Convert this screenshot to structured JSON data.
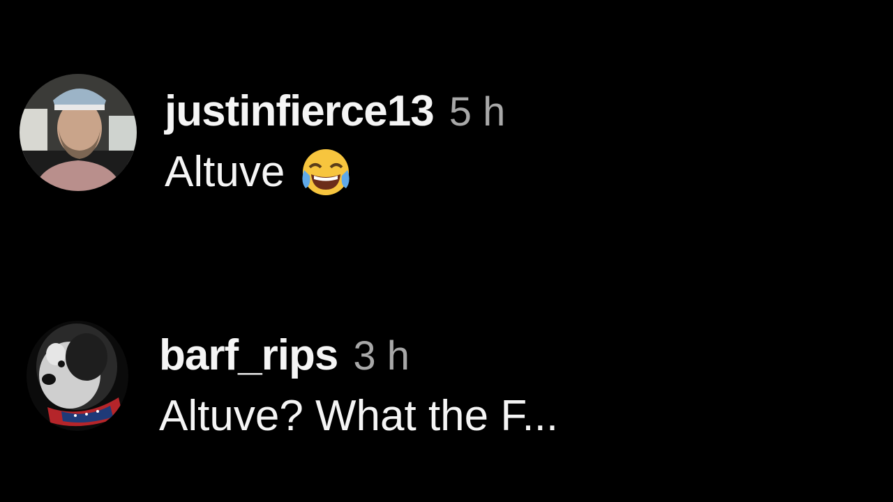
{
  "comments": [
    {
      "username": "justinfierce13",
      "time": "5 h",
      "text": "Altuve",
      "emoji": "face-with-tears-of-joy-icon"
    },
    {
      "username": "barf_rips",
      "time": "3 h",
      "text": "Altuve? What the F..."
    }
  ],
  "colors": {
    "background": "#000000",
    "primary_text": "#f5f5f5",
    "secondary_text": "#a8a8a8"
  }
}
